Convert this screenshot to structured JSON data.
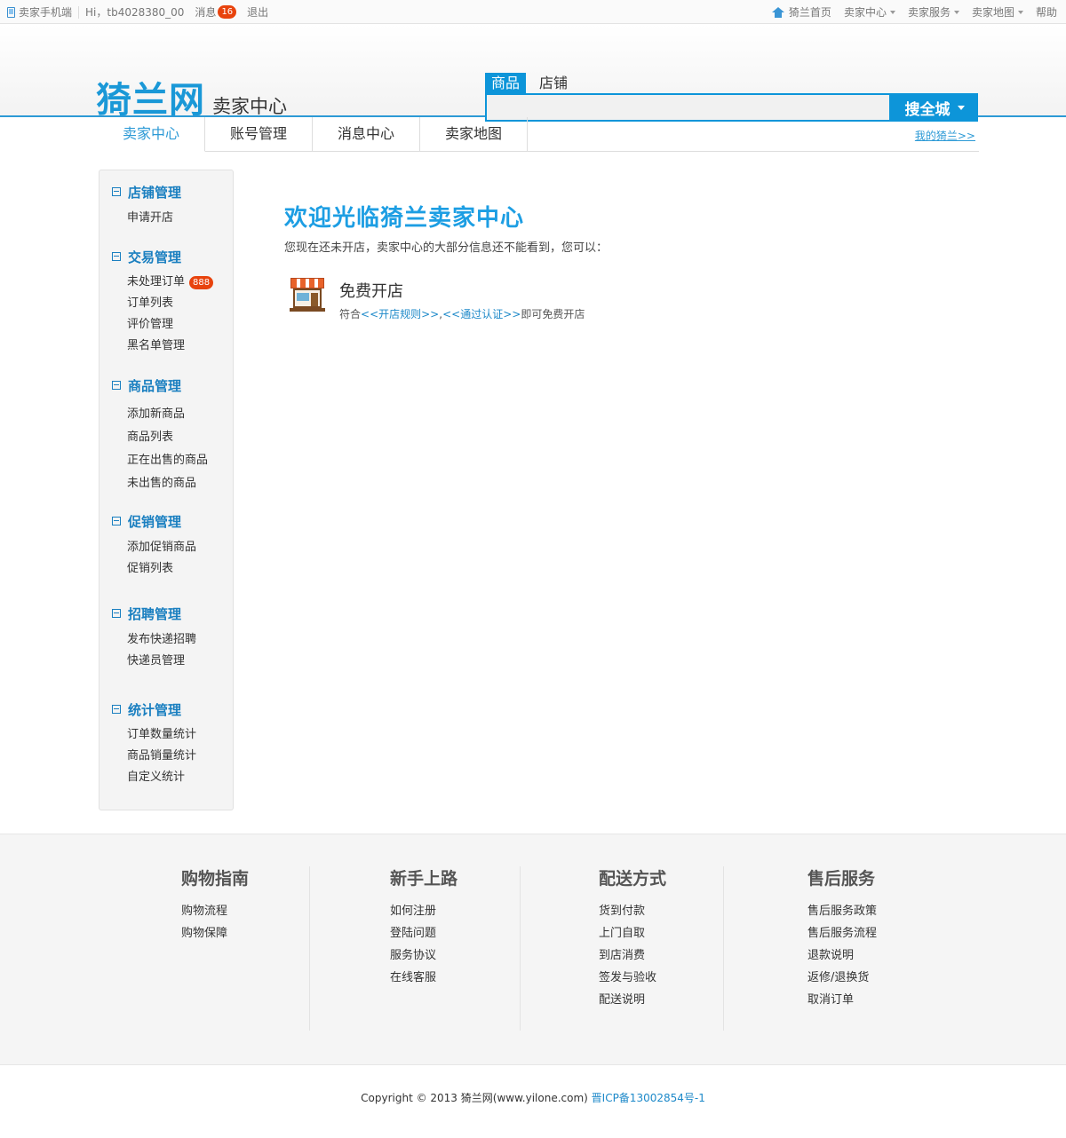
{
  "topbar": {
    "mobile": "卖家手机端",
    "hi": "Hi，",
    "username": "tb4028380_00",
    "messages": "消息",
    "message_count": "16",
    "logout": "退出",
    "home": "猗兰首页",
    "seller_center": "卖家中心",
    "seller_service": "卖家服务",
    "seller_map": "卖家地图",
    "help": "帮助"
  },
  "header": {
    "brand": "猗兰网",
    "subtitle": "卖家中心",
    "search_tabs": [
      "商品",
      "店铺"
    ],
    "search_value": "",
    "search_button": "搜全城"
  },
  "nav": {
    "tabs": [
      "卖家中心",
      "账号管理",
      "消息中心",
      "卖家地图"
    ],
    "my_link": "我的猗兰>>"
  },
  "sidebar": {
    "groups": [
      {
        "title": "店铺管理",
        "items": [
          "申请开店"
        ]
      },
      {
        "title": "交易管理",
        "items": [
          "未处理订单",
          "订单列表",
          "评价管理",
          "黑名单管理"
        ],
        "badge": "888"
      },
      {
        "title": "商品管理",
        "items": [
          "添加新商品",
          "商品列表",
          "正在出售的商品",
          "未出售的商品"
        ]
      },
      {
        "title": "促销管理",
        "items": [
          "添加促销商品",
          "促销列表"
        ]
      },
      {
        "title": "招聘管理",
        "items": [
          "发布快递招聘",
          "快递员管理"
        ]
      },
      {
        "title": "统计管理",
        "items": [
          "订单数量统计",
          "商品销量统计",
          "自定义统计"
        ]
      }
    ]
  },
  "main": {
    "welcome": "欢迎光临猗兰卖家中心",
    "intro": "您现在还未开店，卖家中心的大部分信息还不能看到，您可以：",
    "shop_title": "免费开店",
    "desc_prefix": "符合",
    "rule_link": "<<开店规则>>",
    "comma": ",",
    "cert_link": "<<通过认证>>",
    "desc_suffix": "即可免费开店"
  },
  "footer": {
    "columns": [
      {
        "title": "购物指南",
        "links": [
          "购物流程",
          "购物保障"
        ]
      },
      {
        "title": "新手上路",
        "links": [
          "如何注册",
          "登陆问题",
          "服务协议",
          "在线客服"
        ]
      },
      {
        "title": "配送方式",
        "links": [
          "货到付款",
          "上门自取",
          "到店消费",
          "签发与验收",
          "配送说明"
        ]
      },
      {
        "title": "售后服务",
        "links": [
          "售后服务政策",
          "售后服务流程",
          "退款说明",
          "返修/退换货",
          "取消订单"
        ]
      }
    ],
    "copyright": "Copyright © 2013 猗兰网(www.yilone.com)",
    "icp": "晋ICP备13002854号-1"
  }
}
